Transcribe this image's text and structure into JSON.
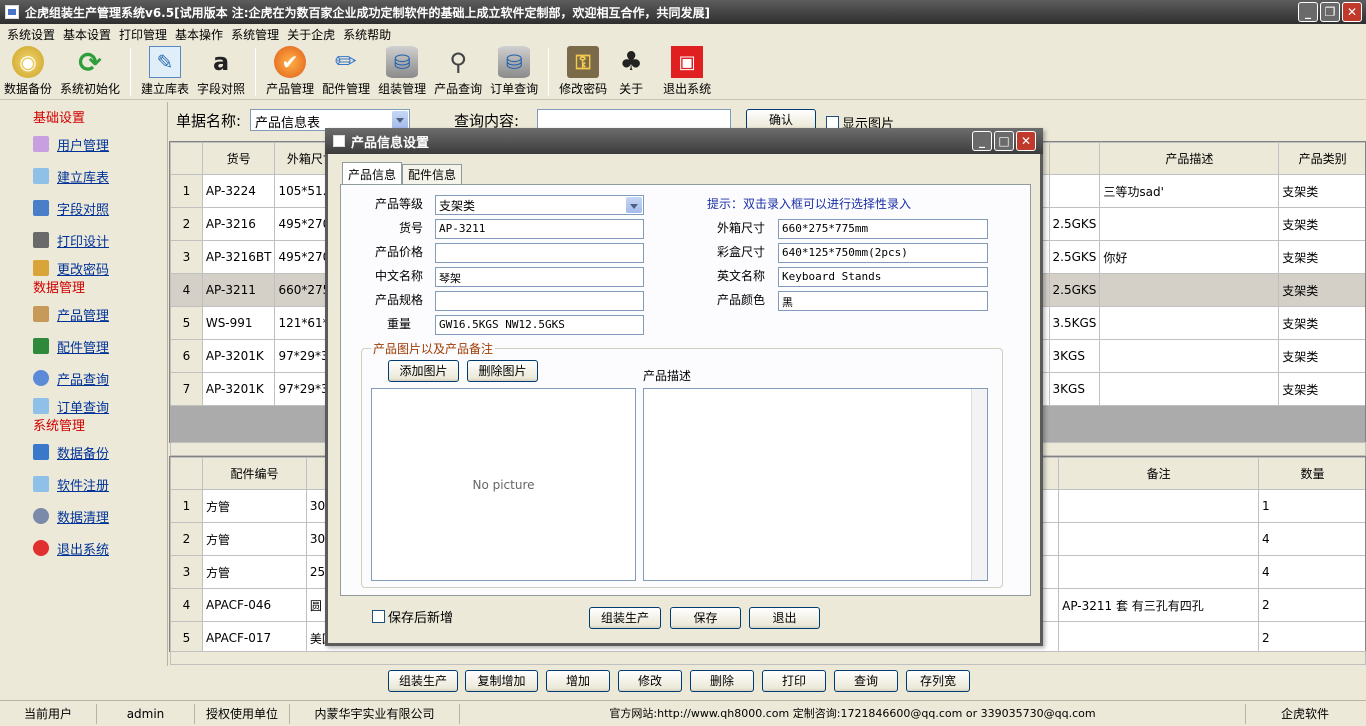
{
  "app": {
    "title": "企虎组装生产管理系统v6.5[试用版本 注:企虎在为数百家企业成功定制软件的基础上成立软件定制部，欢迎相互合作，共同发展]"
  },
  "menu": [
    "系统设置",
    "基本设置",
    "打印管理",
    "基本操作",
    "系统管理",
    "关于企虎",
    "系统帮助"
  ],
  "toolbar": {
    "backup": "数据备份",
    "init": "系统初始化",
    "build_db": "建立库表",
    "fields": "字段对照",
    "products": "产品管理",
    "parts": "配件管理",
    "assembly": "组装管理",
    "product_query": "产品查询",
    "order_query": "订单查询",
    "change_pwd": "修改密码",
    "about": "关于",
    "exit": "退出系统"
  },
  "sidebar": {
    "groups": {
      "basic": "基础设置",
      "data": "数据管理",
      "system": "系统管理"
    },
    "items": {
      "users": "用户管理",
      "build_db": "建立库表",
      "fields": "字段对照",
      "print": "打印设计",
      "pwd": "更改密码",
      "products": "产品管理",
      "parts": "配件管理",
      "product_query": "产品查询",
      "order_query": "订单查询",
      "backup": "数据备份",
      "register": "软件注册",
      "clean": "数据清理",
      "exit": "退出系统"
    }
  },
  "query": {
    "doc_label": "单据名称:",
    "doc_value": "产品信息表",
    "content_label": "查询内容:",
    "content_value": "",
    "confirm": "确认",
    "show_images": "显示图片"
  },
  "top_grid": {
    "headers": {
      "code": "货号",
      "outer": "外箱尺寸",
      "desc": "产品描述",
      "cat": "产品类别"
    },
    "rows": [
      {
        "n": "1",
        "code": "AP-3224",
        "outer": "105*51.5*",
        "weight": "",
        "desc": "三等功sad'",
        "cat": "支架类"
      },
      {
        "n": "2",
        "code": "AP-3216",
        "outer": "495*270*",
        "weight": "2.5GKS",
        "desc": "",
        "cat": "支架类"
      },
      {
        "n": "3",
        "code": "AP-3216BT",
        "outer": "495*270*",
        "weight": "2.5GKS",
        "desc": "你好",
        "cat": "支架类"
      },
      {
        "n": "4",
        "code": "AP-3211",
        "outer": "660*275*",
        "weight": "2.5GKS",
        "desc": "",
        "cat": "支架类"
      },
      {
        "n": "5",
        "code": "WS-991",
        "outer": "121*61*1",
        "weight": "3.5KGS",
        "desc": "",
        "cat": "支架类"
      },
      {
        "n": "6",
        "code": "AP-3201K",
        "outer": "97*29*31",
        "weight": "3KGS",
        "desc": "",
        "cat": "支架类"
      },
      {
        "n": "7",
        "code": "AP-3201K",
        "outer": "97*29*31",
        "weight": "3KGS",
        "desc": "",
        "cat": "支架类"
      }
    ]
  },
  "bottom_grid": {
    "headers": {
      "part_no": "配件编号",
      "note": "备注",
      "qty": "数量"
    },
    "rows": [
      {
        "n": "1",
        "part_no": "方管",
        "spec": "30",
        "note": "",
        "qty": "1"
      },
      {
        "n": "2",
        "part_no": "方管",
        "spec": "30",
        "note": "",
        "qty": "4"
      },
      {
        "n": "3",
        "part_no": "方管",
        "spec": "25",
        "note": "",
        "qty": "4"
      },
      {
        "n": "4",
        "part_no": "APACF-046",
        "spec": "圆",
        "note": "AP-3211   套 有三孔有四孔",
        "qty": "2"
      },
      {
        "n": "5",
        "part_no": "APACF-017",
        "spec": "美国",
        "note": "",
        "qty": "2"
      }
    ]
  },
  "bottom_buttons": [
    "组装生产",
    "复制增加",
    "增加",
    "修改",
    "删除",
    "打印",
    "查询",
    "存列宽"
  ],
  "dialog": {
    "title": "产品信息设置",
    "tabs": [
      "产品信息",
      "配件信息"
    ],
    "hint": "提示：双击录入框可以进行选择性录入",
    "fields": {
      "grade_label": "产品等级",
      "grade_value": "支架类",
      "code_label": "货号",
      "code_value": "AP-3211",
      "price_label": "产品价格",
      "price_value": "",
      "cn_label": "中文名称",
      "cn_value": "琴架",
      "spec_label": "产品规格",
      "spec_value": "",
      "weight_label": "重量",
      "weight_value": "GW16.5KGS NW12.5GKS",
      "outer_label": "外箱尺寸",
      "outer_value": "660*275*775mm",
      "box_label": "彩盒尺寸",
      "box_value": "640*125*750mm(2pcs)",
      "en_label": "英文名称",
      "en_value": "Keyboard Stands",
      "color_label": "产品颜色",
      "color_value": "黑"
    },
    "images_group": "产品图片以及产品备注",
    "add_image": "添加图片",
    "delete_image": "删除图片",
    "no_picture": "No picture",
    "desc_label": "产品描述",
    "save_new": "保存后新增",
    "assemble": "组装生产",
    "save": "保存",
    "exit": "退出"
  },
  "status": {
    "user_label": "当前用户",
    "user": "admin",
    "licensee_label": "授权使用单位",
    "licensee": "内蒙华宇实业有限公司",
    "website": "官方网站:http://www.qh8000.com 定制咨询:1721846600@qq.com or 339035730@qq.com",
    "brand": "企虎软件"
  }
}
